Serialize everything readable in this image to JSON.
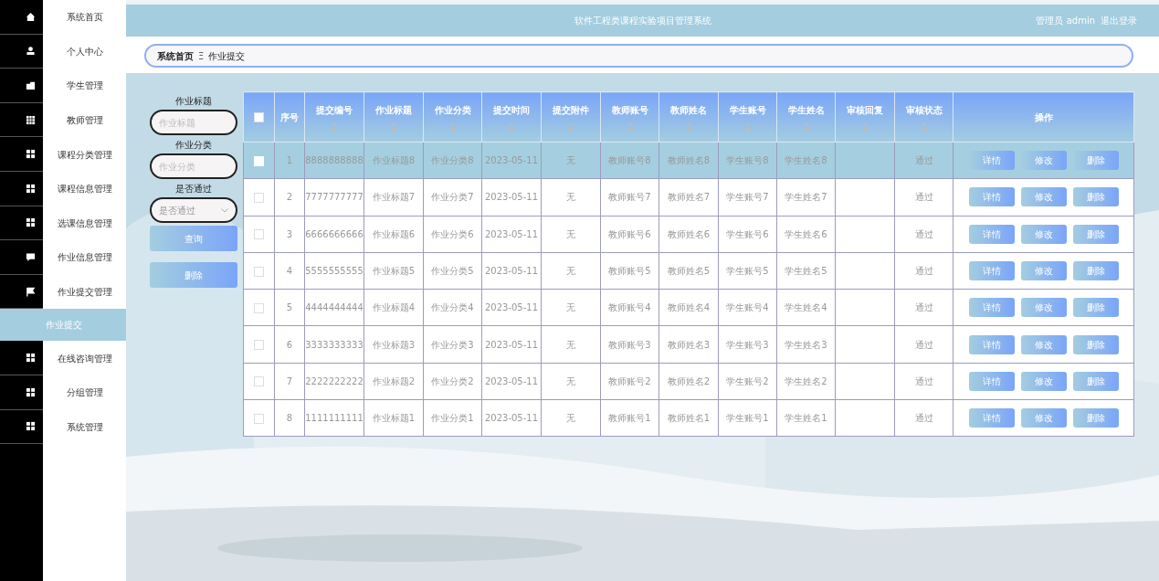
{
  "sidebar": {
    "items": [
      {
        "label": "系统首页",
        "kind": "home",
        "selected": false
      },
      {
        "label": "个人中心",
        "kind": "user",
        "selected": false
      },
      {
        "label": "学生管理",
        "kind": "folder",
        "selected": false
      },
      {
        "label": "教师管理",
        "kind": "table",
        "selected": false
      },
      {
        "label": "课程分类管理",
        "kind": "grid",
        "selected": false
      },
      {
        "label": "课程信息管理",
        "kind": "grid",
        "selected": false
      },
      {
        "label": "选课信息管理",
        "kind": "grid",
        "selected": false
      },
      {
        "label": "作业信息管理",
        "kind": "chat",
        "selected": false
      },
      {
        "label": "作业提交管理",
        "kind": "flag",
        "selected": false,
        "children": [
          {
            "label": "作业提交",
            "selected": true
          }
        ]
      },
      {
        "label": "在线咨询管理",
        "kind": "grid",
        "selected": false
      },
      {
        "label": "分组管理",
        "kind": "grid",
        "selected": false
      },
      {
        "label": "系统管理",
        "kind": "grid",
        "selected": false
      }
    ]
  },
  "header": {
    "title": "软件工程类课程实验项目管理系统",
    "user": "管理员 admin",
    "logout": "退出登录"
  },
  "breadcrumb": {
    "items": [
      "系统首页",
      "作业提交"
    ],
    "separator": "Ξ"
  },
  "filters": {
    "fields": [
      {
        "label": "作业标题",
        "placeholder": "作业标题",
        "kind": "text"
      },
      {
        "label": "作业分类",
        "placeholder": "作业分类",
        "kind": "text"
      },
      {
        "label": "是否通过",
        "placeholder": "是否通过",
        "kind": "select"
      }
    ],
    "buttons": [
      "查询",
      "删除"
    ]
  },
  "table": {
    "select_all": {
      "checked": false
    },
    "columns": [
      {
        "label": "序号",
        "sortable": false
      },
      {
        "label": "提交编号",
        "sortable": true
      },
      {
        "label": "作业标题",
        "sortable": true
      },
      {
        "label": "作业分类",
        "sortable": true
      },
      {
        "label": "提交时间",
        "sortable": true
      },
      {
        "label": "提交附件",
        "sortable": true
      },
      {
        "label": "教师账号",
        "sortable": true
      },
      {
        "label": "教师姓名",
        "sortable": true
      },
      {
        "label": "学生账号",
        "sortable": true
      },
      {
        "label": "学生姓名",
        "sortable": true
      },
      {
        "label": "审核回复",
        "sortable": true
      },
      {
        "label": "审核状态",
        "sortable": true
      },
      {
        "label": "操作",
        "sortable": false
      }
    ],
    "rows": [
      {
        "selected": true,
        "checked": false,
        "cells": [
          "1",
          "8888888888",
          "作业标题8",
          "作业分类8",
          "2023-05-11",
          "无",
          "教师账号8",
          "教师姓名8",
          "学生账号8",
          "学生姓名8",
          "",
          "通过"
        ],
        "actions": [
          "详情",
          "修改",
          "删除"
        ]
      },
      {
        "selected": false,
        "checked": false,
        "cells": [
          "2",
          "7777777777",
          "作业标题7",
          "作业分类7",
          "2023-05-11",
          "无",
          "教师账号7",
          "教师姓名7",
          "学生账号7",
          "学生姓名7",
          "",
          "通过"
        ],
        "actions": [
          "详情",
          "修改",
          "删除"
        ]
      },
      {
        "selected": false,
        "checked": false,
        "cells": [
          "3",
          "6666666666",
          "作业标题6",
          "作业分类6",
          "2023-05-11",
          "无",
          "教师账号6",
          "教师姓名6",
          "学生账号6",
          "学生姓名6",
          "",
          "通过"
        ],
        "actions": [
          "详情",
          "修改",
          "删除"
        ]
      },
      {
        "selected": false,
        "checked": false,
        "cells": [
          "4",
          "5555555555",
          "作业标题5",
          "作业分类5",
          "2023-05-11",
          "无",
          "教师账号5",
          "教师姓名5",
          "学生账号5",
          "学生姓名5",
          "",
          "通过"
        ],
        "actions": [
          "详情",
          "修改",
          "删除"
        ]
      },
      {
        "selected": false,
        "checked": false,
        "cells": [
          "5",
          "4444444444",
          "作业标题4",
          "作业分类4",
          "2023-05-11",
          "无",
          "教师账号4",
          "教师姓名4",
          "学生账号4",
          "学生姓名4",
          "",
          "通过"
        ],
        "actions": [
          "详情",
          "修改",
          "删除"
        ]
      },
      {
        "selected": false,
        "checked": false,
        "cells": [
          "6",
          "3333333333",
          "作业标题3",
          "作业分类3",
          "2023-05-11",
          "无",
          "教师账号3",
          "教师姓名3",
          "学生账号3",
          "学生姓名3",
          "",
          "通过"
        ],
        "actions": [
          "详情",
          "修改",
          "删除"
        ]
      },
      {
        "selected": false,
        "checked": false,
        "cells": [
          "7",
          "2222222222",
          "作业标题2",
          "作业分类2",
          "2023-05-11",
          "无",
          "教师账号2",
          "教师姓名2",
          "学生账号2",
          "学生姓名2",
          "",
          "通过"
        ],
        "actions": [
          "详情",
          "修改",
          "删除"
        ]
      },
      {
        "selected": false,
        "checked": false,
        "cells": [
          "8",
          "1111111111",
          "作业标题1",
          "作业分类1",
          "2023-05-11",
          "无",
          "教师账号1",
          "教师姓名1",
          "学生账号1",
          "学生姓名1",
          "",
          "通过"
        ],
        "actions": [
          "详情",
          "修改",
          "删除"
        ]
      }
    ]
  }
}
